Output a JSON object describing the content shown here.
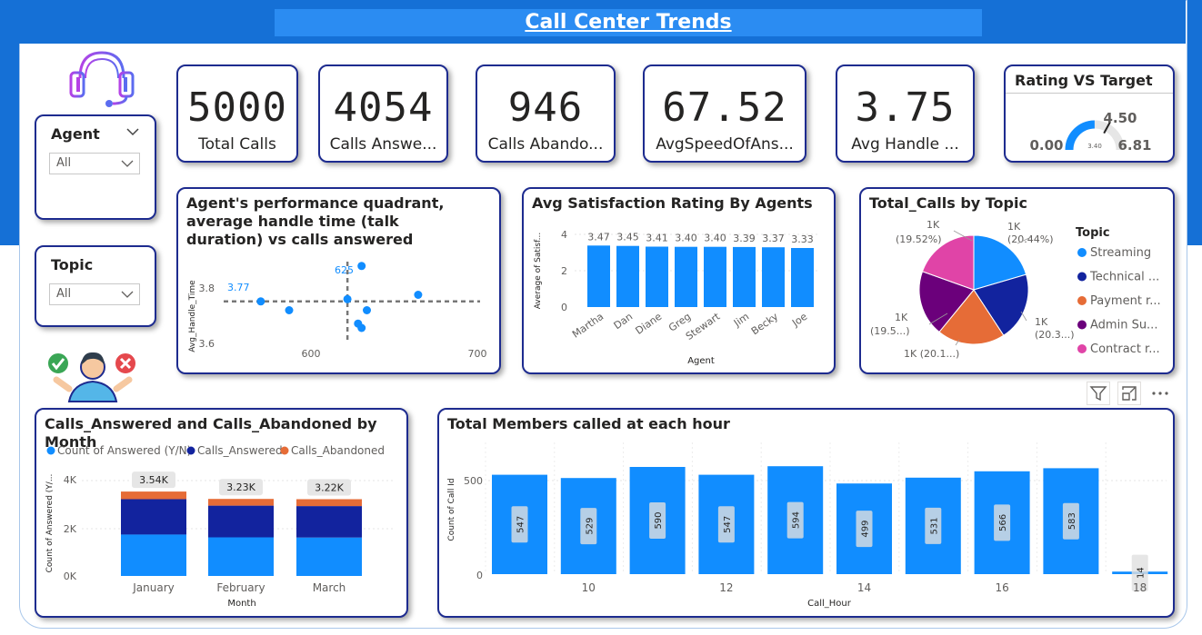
{
  "header": {
    "title": "Call Center Trends"
  },
  "slicers": {
    "agent": {
      "title": "Agent",
      "value": "All"
    },
    "topic": {
      "title": "Topic",
      "value": "All"
    }
  },
  "kpis": [
    {
      "value": "5000",
      "label": "Total Calls"
    },
    {
      "value": "4054",
      "label": "Calls Answe..."
    },
    {
      "value": "946",
      "label": "Calls Abando..."
    },
    {
      "value": "67.52",
      "label": "AvgSpeedOfAns..."
    },
    {
      "value": "3.75",
      "label": "Avg Handle ..."
    }
  ],
  "gauge": {
    "title": "Rating VS Target",
    "min": "0.00",
    "max": "6.81",
    "target": "4.50",
    "value_label": "3.40",
    "value": 3.4,
    "min_v": 0,
    "max_v": 6.81,
    "target_v": 4.5
  },
  "quadrant": {
    "title": "Agent's performance quadrant, average handle time (talk duration) vs calls answered",
    "ylabel": "Avg_Handle_Time",
    "ref_y_label": "3.77",
    "ref_x_label": "625",
    "y_ticks": [
      "3.8",
      "3.6"
    ],
    "x_ticks": [
      "600",
      "700"
    ]
  },
  "satisfaction": {
    "title": "Avg Satisfaction Rating By Agents",
    "ylabel": "Average of Satisf...",
    "xlabel": "Agent",
    "y_ticks": [
      "4",
      "2",
      "0"
    ]
  },
  "pie": {
    "title": "Total_Calls by Topic",
    "legend_title": "Topic",
    "legend": [
      "Streaming",
      "Technical ...",
      "Payment r...",
      "Admin Su...",
      "Contract r..."
    ],
    "labels": {
      "streaming": [
        "1K",
        "(20.44%)"
      ],
      "technical": [
        "1K",
        "(20.3...)"
      ],
      "payment": [
        "1K (20.1...)"
      ],
      "admin": [
        "1K",
        "(19.5...)"
      ],
      "contract": [
        "1K",
        "(19.52%)"
      ]
    }
  },
  "monthly": {
    "title": "Calls_Answered and Calls_Abandoned by Month",
    "legend": [
      "Count of Answered (Y/N)",
      "Calls_Answered",
      "Calls_Abandoned"
    ],
    "ylabel": "Count of Answered (Y/...",
    "xlabel": "Month",
    "y_ticks": [
      "4K",
      "2K",
      "0K"
    ],
    "totals": [
      "3.54K",
      "3.23K",
      "3.22K"
    ]
  },
  "hourly": {
    "title": "Total Members called at each hour",
    "ylabel": "Count of Call Id",
    "xlabel": "Call_Hour",
    "y_ticks": [
      "500",
      "0"
    ],
    "x_ticks": [
      "10",
      "12",
      "14",
      "16",
      "18"
    ]
  },
  "colors": {
    "accent": "#1570d6",
    "bar": "#118dff",
    "navy": "#12239e",
    "orange": "#e66c37",
    "purple": "#6b007b",
    "pink": "#e044a7",
    "border": "#1d2b8f"
  },
  "chart_data": [
    {
      "type": "scatter",
      "title": "Agent's performance quadrant, average handle time (talk duration) vs calls answered",
      "xlabel": "",
      "ylabel": "Avg_Handle_Time",
      "xlim": [
        555,
        700
      ],
      "ylim": [
        3.56,
        3.97
      ],
      "points": [
        [
          576,
          3.77
        ],
        [
          592,
          3.73
        ],
        [
          625,
          3.78
        ],
        [
          633,
          3.93
        ],
        [
          636,
          3.73
        ],
        [
          631,
          3.67
        ],
        [
          633,
          3.65
        ],
        [
          665,
          3.8
        ]
      ],
      "reference_lines": {
        "x": 625,
        "y": 3.77
      }
    },
    {
      "type": "bar",
      "title": "Avg Satisfaction Rating By Agents",
      "xlabel": "Agent",
      "ylabel": "Average of Satisf...",
      "ylim": [
        0,
        4.1
      ],
      "categories": [
        "Martha",
        "Dan",
        "Diane",
        "Greg",
        "Stewart",
        "Jim",
        "Becky",
        "Joe"
      ],
      "values": [
        3.47,
        3.45,
        3.41,
        3.4,
        3.4,
        3.39,
        3.37,
        3.33
      ]
    },
    {
      "type": "pie",
      "title": "Total_Calls by Topic",
      "categories": [
        "Streaming",
        "Technical ...",
        "Payment r...",
        "Admin Su...",
        "Contract r..."
      ],
      "values": [
        20.44,
        20.3,
        20.1,
        19.5,
        19.52
      ]
    },
    {
      "type": "bar",
      "title": "Calls_Answered and Calls_Abandoned by Month",
      "xlabel": "Month",
      "ylabel": "Count of Answered (Y/...",
      "ylim": [
        0,
        4000
      ],
      "categories": [
        "January",
        "February",
        "March"
      ],
      "series": [
        {
          "name": "Count of Answered (Y/N)",
          "values": [
            1740,
            1620,
            1610
          ]
        },
        {
          "name": "Calls_Answered",
          "values": [
            1480,
            1330,
            1320
          ]
        },
        {
          "name": "Calls_Abandoned",
          "values": [
            320,
            280,
            290
          ]
        }
      ]
    },
    {
      "type": "bar",
      "title": "Total Members called at each hour",
      "xlabel": "Call_Hour",
      "ylabel": "Count of Call Id",
      "ylim": [
        0,
        630
      ],
      "categories": [
        "9",
        "10",
        "11",
        "12",
        "13",
        "14",
        "15",
        "16",
        "17",
        "18"
      ],
      "values": [
        547,
        529,
        590,
        547,
        594,
        499,
        531,
        566,
        583,
        14
      ],
      "bar_labels": [
        "547",
        "529",
        "590",
        "547",
        "594",
        "499",
        "531",
        "566",
        "583",
        "14"
      ]
    }
  ]
}
